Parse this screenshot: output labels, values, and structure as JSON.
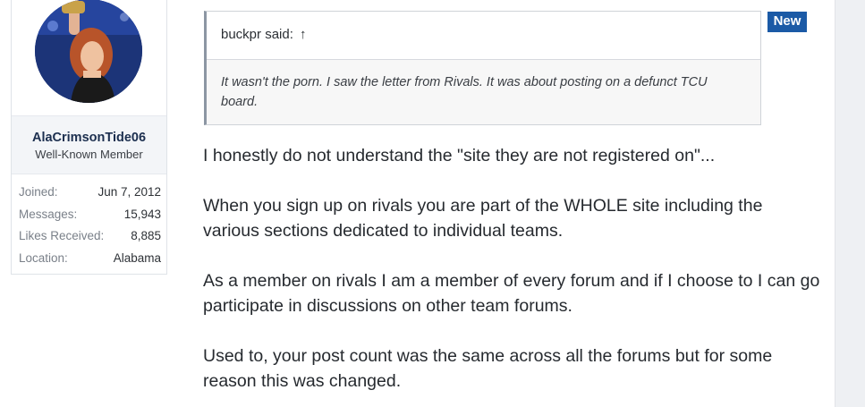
{
  "user": {
    "username": "AlaCrimsonTide06",
    "title": "Well-Known Member",
    "stats": [
      {
        "key": "Joined:",
        "value": "Jun 7, 2012"
      },
      {
        "key": "Messages:",
        "value": "15,943"
      },
      {
        "key": "Likes Received:",
        "value": "8,885"
      },
      {
        "key": "Location:",
        "value": "Alabama"
      }
    ]
  },
  "badge": {
    "label": "New",
    "color": "#1b5aa6"
  },
  "quote": {
    "author_text": "buckpr said:",
    "arrow_icon": "↑",
    "body": "It wasn't the porn. I saw the letter from Rivals. It was about posting on a defunct TCU board."
  },
  "message": {
    "paragraphs": [
      "I honestly do not understand the \"site they are not registered on\"...",
      "When you sign up on rivals you are part of the WHOLE site including the various sections dedicated to individual teams.",
      "As a member on rivals I am a member of every forum and if I choose to I can go participate in discussions on other team forums.",
      "Used to, your post count was the same across all the forums but for some reason this was changed."
    ]
  }
}
